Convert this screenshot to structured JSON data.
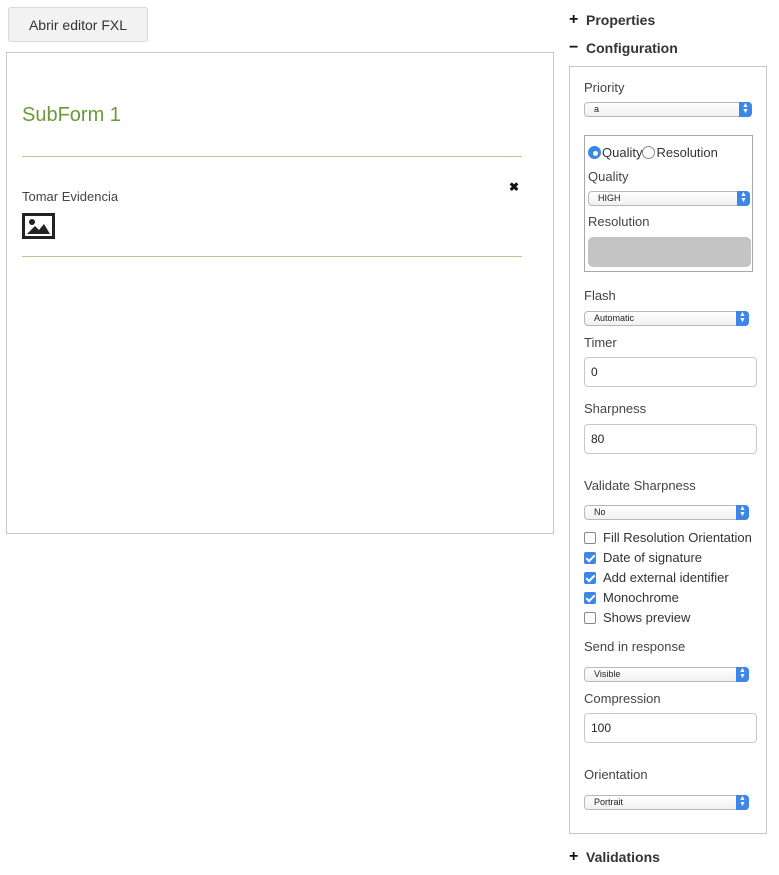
{
  "toolbar": {
    "open_editor_label": "Abrir editor FXL"
  },
  "canvas": {
    "subform_title": "SubForm 1",
    "field_label": "Tomar Evidencia",
    "remove_symbol": "✖"
  },
  "panel": {
    "properties": {
      "symbol": "+",
      "title": "Properties"
    },
    "configuration": {
      "symbol": "−",
      "title": "Configuration"
    },
    "validations": {
      "symbol": "+",
      "title": "Validations"
    }
  },
  "config": {
    "priority_label": "Priority",
    "priority_value": "a",
    "mode_options": [
      "Quality",
      "Resolution"
    ],
    "mode_selected": "Quality",
    "quality_label": "Quality",
    "quality_value": "HIGH",
    "resolution_label": "Resolution",
    "flash_label": "Flash",
    "flash_value": "Automatic",
    "timer_label": "Timer",
    "timer_value": "0",
    "sharpness_label": "Sharpness",
    "sharpness_value": "80",
    "validate_sharpness_label": "Validate Sharpness",
    "validate_sharpness_value": "No",
    "checkboxes": [
      {
        "label": "Fill Resolution Orientation",
        "checked": false
      },
      {
        "label": "Date of signature",
        "checked": true
      },
      {
        "label": "Add external identifier",
        "checked": true
      },
      {
        "label": "Monochrome",
        "checked": true
      },
      {
        "label": "Shows preview",
        "checked": false
      }
    ],
    "send_in_response_label": "Send in response",
    "send_in_response_value": "Visible",
    "compression_label": "Compression",
    "compression_value": "100",
    "orientation_label": "Orientation",
    "orientation_value": "Portrait"
  },
  "colors": {
    "accent": "#3b86e6",
    "subform_title": "#6a9a3a",
    "divider": "#b6c98e"
  },
  "icons": [
    "image-icon",
    "close-icon",
    "plus-icon",
    "minus-icon",
    "select-arrows-icon",
    "radio-icon",
    "checkbox-icon"
  ]
}
